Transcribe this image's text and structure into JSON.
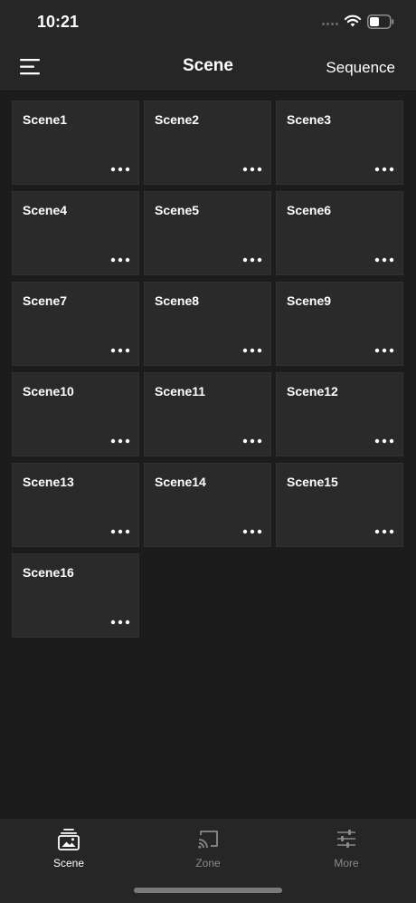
{
  "status_bar": {
    "time": "10:21",
    "icons": [
      "cellular-dots-icon",
      "wifi-icon",
      "battery-icon"
    ]
  },
  "header": {
    "title": "Scene",
    "menu_icon": "hamburger-menu-icon",
    "sequence_label": "Sequence"
  },
  "scenes": [
    {
      "label": "Scene1"
    },
    {
      "label": "Scene2"
    },
    {
      "label": "Scene3"
    },
    {
      "label": "Scene4"
    },
    {
      "label": "Scene5"
    },
    {
      "label": "Scene6"
    },
    {
      "label": "Scene7"
    },
    {
      "label": "Scene8"
    },
    {
      "label": "Scene9"
    },
    {
      "label": "Scene10"
    },
    {
      "label": "Scene11"
    },
    {
      "label": "Scene12"
    },
    {
      "label": "Scene13"
    },
    {
      "label": "Scene14"
    },
    {
      "label": "Scene15"
    },
    {
      "label": "Scene16"
    }
  ],
  "tab_bar": {
    "tabs": [
      {
        "label": "Scene",
        "icon": "scene-stack-icon",
        "active": true
      },
      {
        "label": "Zone",
        "icon": "cast-icon",
        "active": false
      },
      {
        "label": "More",
        "icon": "sliders-icon",
        "active": false
      }
    ]
  },
  "colors": {
    "background": "#1c1c1c",
    "bars": "#262626",
    "card": "#2a2a2a",
    "text": "#ffffff",
    "inactive_tab": "#8a8a8a"
  }
}
